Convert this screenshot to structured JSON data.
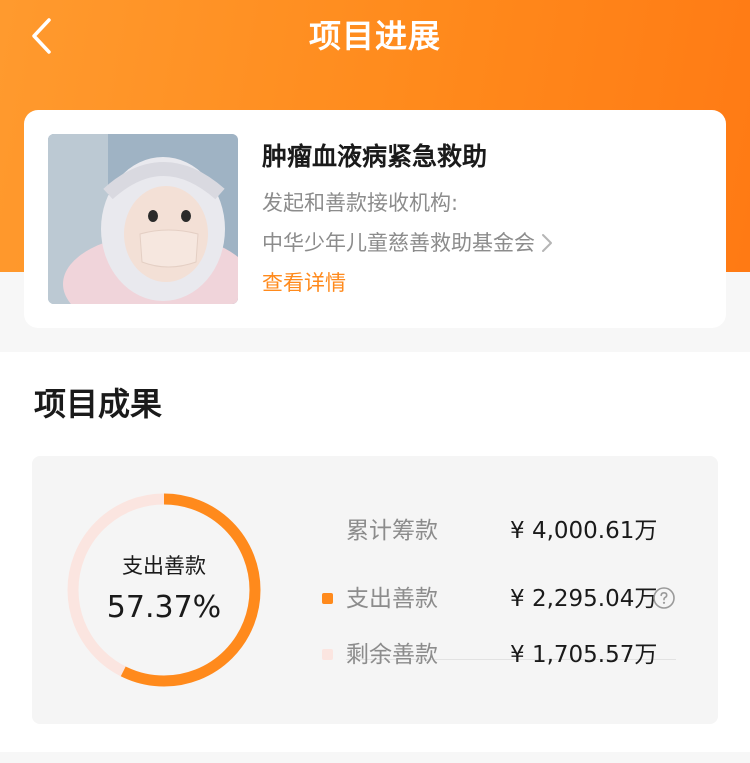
{
  "nav": {
    "title": "项目进展"
  },
  "project": {
    "name": "肿瘤血液病紧急救助",
    "org_label": "发起和善款接收机构:",
    "org_name": "中华少年儿童慈善救助基金会",
    "detail_link": "查看详情"
  },
  "results": {
    "title": "项目成果",
    "ring": {
      "label": "支出善款",
      "percent_text": "57.37%",
      "percent_value": 57.37
    },
    "stats": [
      {
        "label": "累计筹款",
        "value": "¥ 4,000.61万"
      },
      {
        "label": "支出善款",
        "value": "¥ 2,295.04万",
        "dot_color": "#ff8a1c"
      },
      {
        "label": "剩余善款",
        "value": "¥ 1,705.57万",
        "dot_color": "#fbe5e0"
      }
    ]
  },
  "colors": {
    "accent": "#ff8a1c",
    "ring_track": "#fbe5e0"
  },
  "icons": {
    "back": "chevron-left-icon",
    "org_chevron": "chevron-right-icon",
    "help": "question-circle-icon"
  }
}
